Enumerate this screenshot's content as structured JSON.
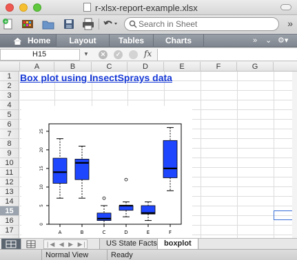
{
  "window": {
    "title": "r-xlsx-report-example.xlsx"
  },
  "toolbar": {
    "search_placeholder": "Search in Sheet",
    "icons": [
      "new-file-icon",
      "template-gallery-icon",
      "open-folder-icon",
      "save-icon",
      "print-icon",
      "undo-icon"
    ]
  },
  "ribbon": {
    "tabs": [
      "Home",
      "Layout",
      "Tables",
      "Charts"
    ],
    "active": "Home"
  },
  "formula_bar": {
    "name_box": "H15",
    "fx_label": "fx",
    "formula": ""
  },
  "grid": {
    "columns": [
      "A",
      "B",
      "C",
      "D",
      "E",
      "F",
      "G"
    ],
    "rows": [
      "1",
      "2",
      "3",
      "4",
      "5",
      "6",
      "7",
      "8",
      "9",
      "10",
      "11",
      "12",
      "13",
      "14",
      "15",
      "16",
      "17"
    ],
    "selected_row": "15",
    "selected_cell": "H15",
    "a1_text": "Box plot using InsectSprays data"
  },
  "chart_data": {
    "type": "box",
    "title": "",
    "xlabel": "",
    "ylabel": "",
    "categories": [
      "A",
      "B",
      "C",
      "D",
      "E",
      "F"
    ],
    "yticks": [
      0,
      5,
      10,
      15,
      20,
      25
    ],
    "ylim": [
      0,
      27
    ],
    "box_color": "#1e46ff",
    "boxes": [
      {
        "label": "A",
        "min": 7,
        "q1": 11,
        "median": 14,
        "q3": 17.75,
        "max": 23,
        "outliers": []
      },
      {
        "label": "B",
        "min": 7,
        "q1": 12,
        "median": 16.5,
        "q3": 17.5,
        "max": 21,
        "outliers": []
      },
      {
        "label": "C",
        "min": 0,
        "q1": 1,
        "median": 1.5,
        "q3": 3,
        "max": 5,
        "outliers": [
          7
        ]
      },
      {
        "label": "D",
        "min": 2,
        "q1": 3.75,
        "median": 5,
        "q3": 5,
        "max": 6,
        "outliers": [
          12
        ]
      },
      {
        "label": "E",
        "min": 1,
        "q1": 2.75,
        "median": 3,
        "q3": 5,
        "max": 6,
        "outliers": []
      },
      {
        "label": "F",
        "min": 9,
        "q1": 12.5,
        "median": 15,
        "q3": 22.5,
        "max": 26,
        "outliers": []
      }
    ]
  },
  "sheet_tabs": {
    "tabs": [
      "US State Facts",
      "boxplot"
    ],
    "active": "boxplot"
  },
  "status_bar": {
    "view": "Normal View",
    "status": "Ready"
  }
}
